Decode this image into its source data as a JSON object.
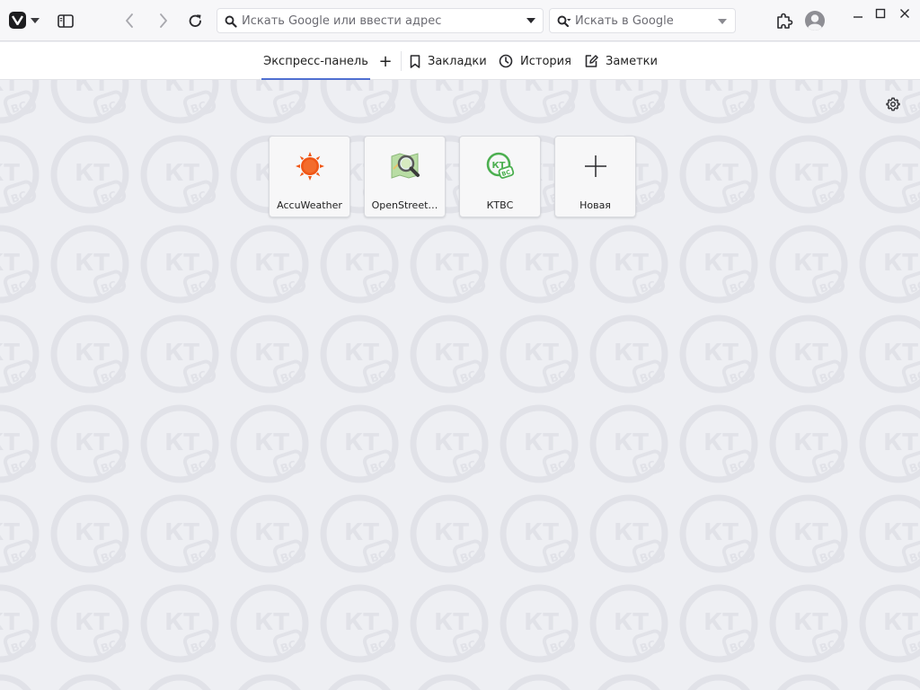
{
  "toolbar": {
    "address_placeholder": "Искать Google или ввести адрес",
    "search_placeholder": "Искать в Google"
  },
  "tabs": {
    "speed_dial": "Экспресс-панель",
    "add": "+",
    "bookmarks": "Закладки",
    "history": "История",
    "notes": "Заметки"
  },
  "speed_dials": [
    {
      "title": "AccuWeather",
      "icon": "sun-icon"
    },
    {
      "title": "OpenStreet…",
      "icon": "map-magnifier-icon"
    },
    {
      "title": "КТВС",
      "icon": "ktvs-logo"
    },
    {
      "title": "Новая",
      "icon": "plus-icon"
    }
  ],
  "colors": {
    "accent": "#4f6fd1",
    "accuweather": "#f05514",
    "ktvs": "#4caf50",
    "background": "#eeeff3"
  }
}
